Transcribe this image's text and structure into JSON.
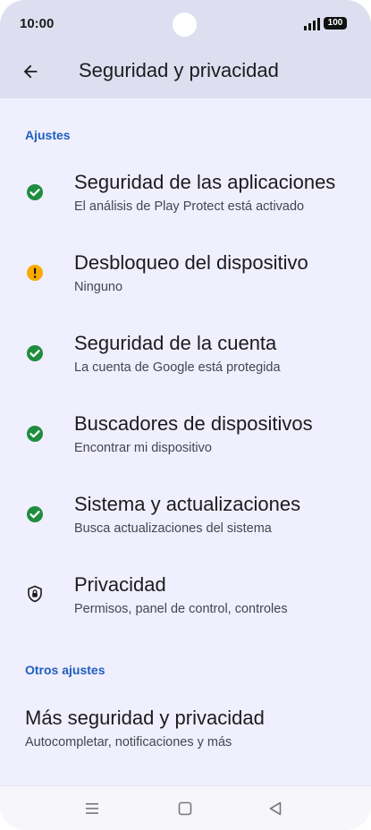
{
  "status_bar": {
    "time": "10:00",
    "battery": "100",
    "icons": [
      "camera-cutout",
      "signal-icon",
      "battery-icon"
    ]
  },
  "app_bar": {
    "title": "Seguridad y privacidad",
    "back_icon": "arrow-back-icon"
  },
  "sections": {
    "ajustes_label": "Ajustes",
    "otros_label": "Otros ajustes"
  },
  "items": [
    {
      "title": "Seguridad de las aplicaciones",
      "subtitle": "El análisis de Play Protect está activado",
      "icon": "check-circle-icon",
      "status_color": "#1e8e3e"
    },
    {
      "title": "Desbloqueo del dispositivo",
      "subtitle": "Ninguno",
      "icon": "warning-circle-icon",
      "status_color": "#f9ab00"
    },
    {
      "title": "Seguridad de la cuenta",
      "subtitle": "La cuenta de Google está protegida",
      "icon": "check-circle-icon",
      "status_color": "#1e8e3e"
    },
    {
      "title": "Buscadores de dispositivos",
      "subtitle": "Encontrar mi dispositivo",
      "icon": "check-circle-icon",
      "status_color": "#1e8e3e"
    },
    {
      "title": "Sistema y actualizaciones",
      "subtitle": "Busca actualizaciones del sistema",
      "icon": "check-circle-icon",
      "status_color": "#1e8e3e"
    },
    {
      "title": "Privacidad",
      "subtitle": "Permisos, panel de control, controles",
      "icon": "privacy-shield-icon",
      "status_color": "#1b1b1f"
    }
  ],
  "more": {
    "title": "Más seguridad y privacidad",
    "subtitle": "Autocompletar, notificaciones y más"
  },
  "nav_bar": {
    "icons": [
      "menu-icon",
      "home-icon",
      "back-triangle-icon"
    ]
  },
  "colors": {
    "accent": "#1f5fbf",
    "background": "#f0effd",
    "header": "#dddff0"
  }
}
